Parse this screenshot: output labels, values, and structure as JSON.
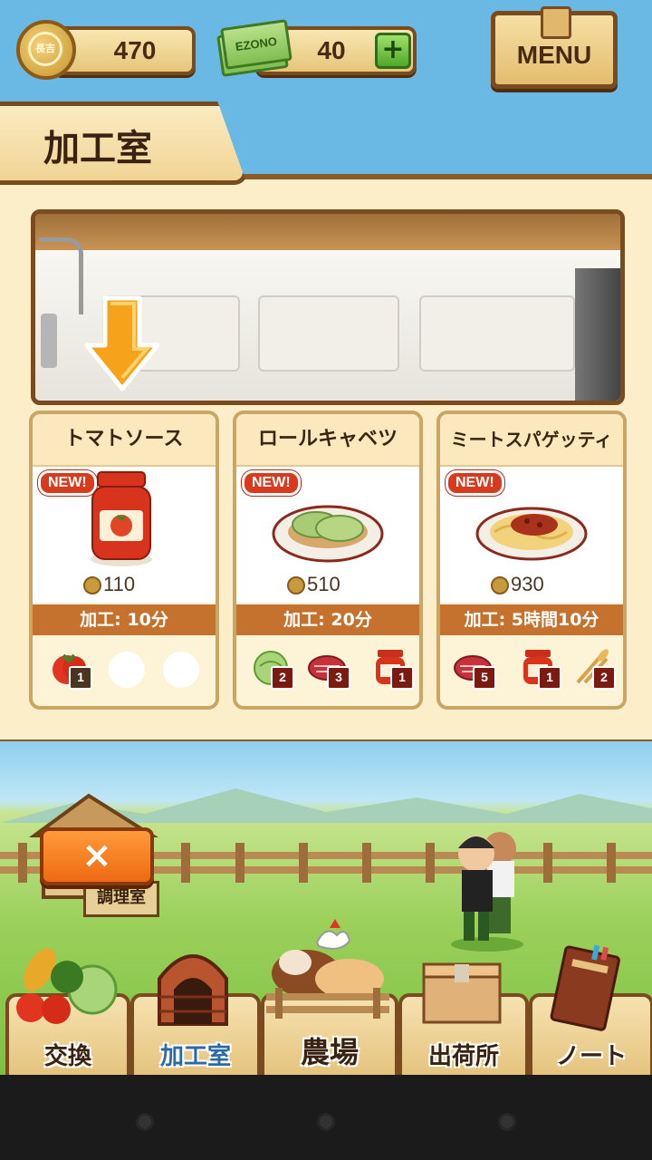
{
  "hud": {
    "coins": "470",
    "coin_symbol": "長吉",
    "tickets": "40",
    "ticket_label": "EZONO",
    "add_label": "+",
    "menu_label": "MENU"
  },
  "screen_title": "加工室",
  "recipes": [
    {
      "name": "トマトソース",
      "badge": "NEW!",
      "price": "110",
      "time": "加工: 10分",
      "ingredients": [
        {
          "icon": "tomato-icon",
          "count": "1"
        }
      ]
    },
    {
      "name": "ロールキャベツ",
      "badge": "NEW!",
      "price": "510",
      "time": "加工: 20分",
      "ingredients": [
        {
          "icon": "cabbage-icon",
          "count": "2"
        },
        {
          "icon": "meat-icon",
          "count": "3"
        },
        {
          "icon": "tomato-sauce-icon",
          "count": "1"
        }
      ]
    },
    {
      "name": "ミートスパゲッティ",
      "badge": "NEW!",
      "price": "930",
      "time": "加工: 5時間10分",
      "ingredients": [
        {
          "icon": "meat-icon",
          "count": "5"
        },
        {
          "icon": "tomato-sauce-icon",
          "count": "1"
        },
        {
          "icon": "wheat-icon",
          "count": "2"
        }
      ]
    }
  ],
  "scene": {
    "close_label": "×",
    "building_sign": "調理室"
  },
  "bottom_nav": [
    {
      "label": "交換"
    },
    {
      "label": "加工室"
    },
    {
      "label": "農場"
    },
    {
      "label": "出荷所"
    },
    {
      "label": "ノート"
    }
  ],
  "colors": {
    "accent": "#c4722e",
    "badge": "#d83a1e",
    "wood": "#7a4b1e"
  }
}
